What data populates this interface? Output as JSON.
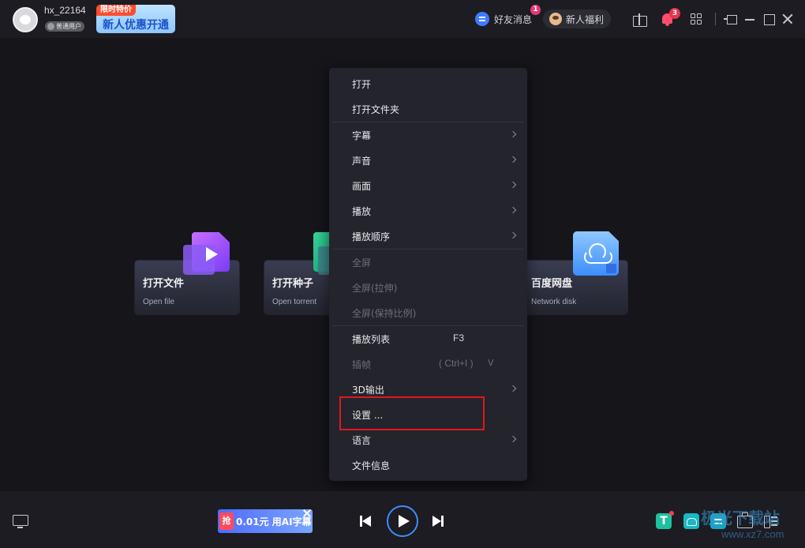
{
  "titlebar": {
    "username": "hx_22164",
    "user_level": "普通用户",
    "promo_tag": "限时特价",
    "promo_text": "新人优惠开通",
    "friend_messages": "好友消息",
    "friend_badge": "1",
    "newbie_benefit": "新人福利",
    "notification_badge": "3"
  },
  "cards": [
    {
      "title": "打开文件",
      "subtitle": "Open file"
    },
    {
      "title": "打开种子",
      "subtitle": "Open torrent"
    },
    {
      "title": "百度网盘",
      "subtitle": "Network disk"
    }
  ],
  "context_menu": {
    "items": [
      {
        "label": "打开",
        "enabled": true
      },
      {
        "label": "打开文件夹",
        "enabled": true
      },
      {
        "label": "字幕",
        "enabled": true,
        "submenu": true
      },
      {
        "label": "声音",
        "enabled": true,
        "submenu": true
      },
      {
        "label": "画面",
        "enabled": true,
        "submenu": true
      },
      {
        "label": "播放",
        "enabled": true,
        "submenu": true
      },
      {
        "label": "播放顺序",
        "enabled": true,
        "submenu": true
      },
      {
        "label": "全屏",
        "enabled": false
      },
      {
        "label": "全屏(拉伸)",
        "enabled": false
      },
      {
        "label": "全屏(保持比例)",
        "enabled": false
      },
      {
        "label": "播放列表",
        "enabled": true,
        "shortcut": "F3"
      },
      {
        "label": "插帧",
        "enabled": false,
        "shortcut": "( Ctrl+I )",
        "mark": "V"
      },
      {
        "label": "3D输出",
        "enabled": true,
        "submenu": true
      },
      {
        "label": "设置 ...",
        "enabled": true,
        "highlighted": true
      },
      {
        "label": "语言",
        "enabled": true,
        "submenu": true
      },
      {
        "label": "文件信息",
        "enabled": true
      }
    ]
  },
  "bottombar": {
    "ad_grab": "抢",
    "ad_text": "0.01元 用AI字幕"
  },
  "watermark": {
    "text": "极光下载站",
    "url": "www.xz7.com"
  },
  "colors": {
    "accent": "#3d8dff",
    "highlight_border": "#e0181f",
    "background": "#15151a"
  }
}
